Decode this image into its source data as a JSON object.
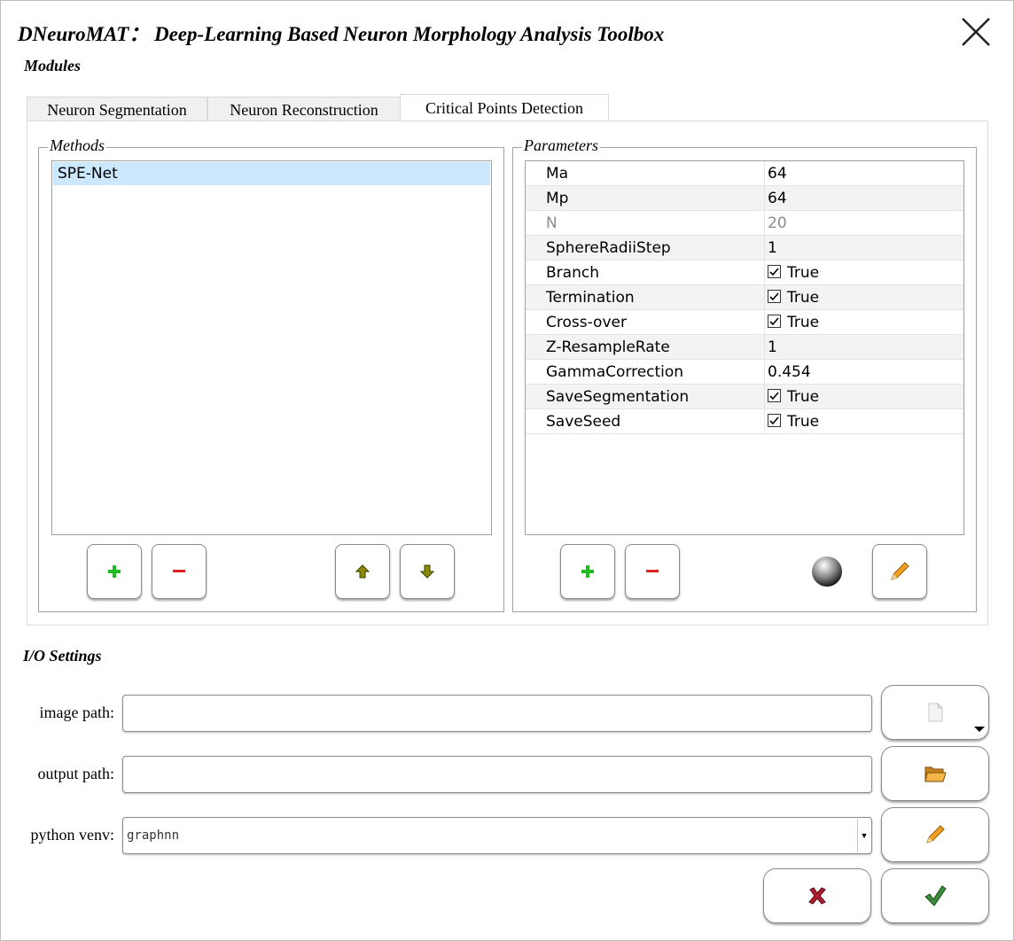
{
  "window": {
    "title": "DNeuroMAT：  Deep-Learning Based Neuron Morphology Analysis Toolbox"
  },
  "modules": {
    "label": "Modules",
    "tabs": [
      {
        "label": "Neuron Segmentation",
        "active": false
      },
      {
        "label": "Neuron Reconstruction",
        "active": false
      },
      {
        "label": "Critical Points Detection",
        "active": true
      }
    ]
  },
  "methods": {
    "title": "Methods",
    "items": [
      "SPE-Net"
    ],
    "selected_index": 0,
    "buttons": {
      "add_icon": "plus-icon",
      "remove_icon": "minus-icon",
      "up_icon": "arrow-up-icon",
      "down_icon": "arrow-down-icon"
    }
  },
  "parameters": {
    "title": "Parameters",
    "rows": [
      {
        "key": "Ma",
        "value": "64",
        "checkbox": false,
        "disabled": false
      },
      {
        "key": "Mp",
        "value": "64",
        "checkbox": false,
        "disabled": false
      },
      {
        "key": "N",
        "value": "20",
        "checkbox": false,
        "disabled": true
      },
      {
        "key": "SphereRadiiStep",
        "value": "1",
        "checkbox": false,
        "disabled": false
      },
      {
        "key": "Branch",
        "value": "True",
        "checkbox": true,
        "disabled": false
      },
      {
        "key": "Termination",
        "value": "True",
        "checkbox": true,
        "disabled": false
      },
      {
        "key": "Cross-over",
        "value": "True",
        "checkbox": true,
        "disabled": false
      },
      {
        "key": "Z-ResampleRate",
        "value": "1",
        "checkbox": false,
        "disabled": false
      },
      {
        "key": "GammaCorrection",
        "value": "0.454",
        "checkbox": false,
        "disabled": false
      },
      {
        "key": "SaveSegmentation",
        "value": "True",
        "checkbox": true,
        "disabled": false
      },
      {
        "key": "SaveSeed",
        "value": "True",
        "checkbox": true,
        "disabled": false
      }
    ],
    "buttons": {
      "add_icon": "plus-icon",
      "remove_icon": "minus-icon",
      "status_icon": "sphere-icon",
      "edit_icon": "pencil-icon"
    }
  },
  "io": {
    "label": "I/O Settings",
    "image_path": {
      "label": "image path:",
      "value": ""
    },
    "output_path": {
      "label": "output path:",
      "value": ""
    },
    "python_venv": {
      "label": "python venv:",
      "value": "graphnn"
    }
  },
  "colors": {
    "selection": "#cce8ff",
    "plus": "#22bb22",
    "minus": "#dd2222",
    "arrows": "#8a8a00",
    "cancel": "#b02030",
    "ok": "#2e7d32"
  }
}
